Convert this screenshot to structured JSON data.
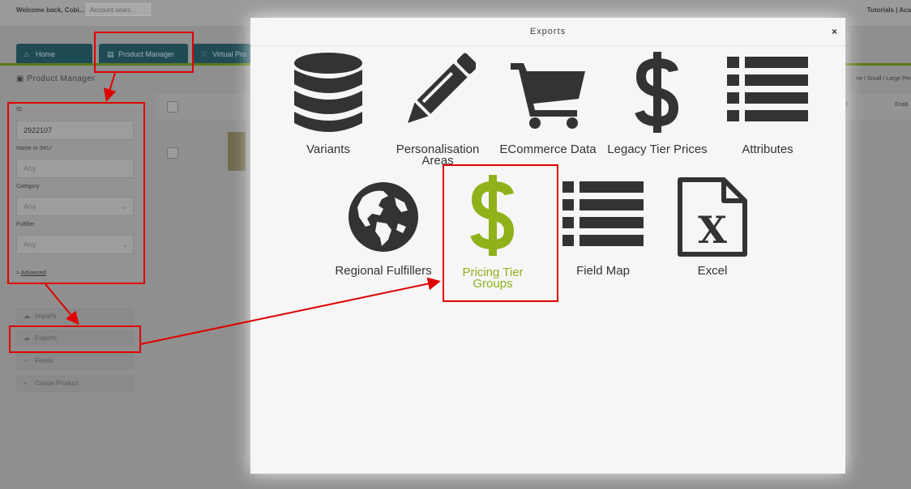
{
  "header": {
    "welcome_text": "Welcome back, Cobi...",
    "search_placeholder": "Account searc...",
    "tutorials_text": "Tutorials | Aca"
  },
  "nav": {
    "tabs": [
      {
        "label": "Home"
      },
      {
        "label": "Product Manager"
      },
      {
        "label": "Virtual Pro"
      }
    ]
  },
  "page": {
    "title": "Product Manager",
    "size_links": "ne / Small / Large  Per",
    "column_partial_1": "d",
    "column_partial_2": "Enab"
  },
  "filters": {
    "id_label": "ID",
    "id_value": "2922107",
    "name_label": "Name or SKU",
    "name_value": "Any",
    "category_label": "Category",
    "category_value": "Any",
    "fulfiller_label": "Fulfiller",
    "fulfiller_value": "Any",
    "advanced_prefix": "> ",
    "advanced_link": "Advanced"
  },
  "actions": {
    "imports": "Imports",
    "exports": "Exports",
    "feeds": "Feeds",
    "create_product": "Create Product"
  },
  "modal": {
    "title": "Exports",
    "close": "×",
    "items": [
      {
        "label": "Variants",
        "icon": "database-icon"
      },
      {
        "label": "Personalisation Areas",
        "icon": "pencil-icon"
      },
      {
        "label": "ECommerce Data",
        "icon": "shopping-cart-icon"
      },
      {
        "label": "Legacy Tier Prices",
        "icon": "dollar-icon"
      },
      {
        "label": "Attributes",
        "icon": "list-icon"
      },
      {
        "label": "Regional Fulfillers",
        "icon": "globe-icon"
      },
      {
        "label": "Pricing Tier Groups",
        "icon": "dollar-icon"
      },
      {
        "label": "Field Map",
        "icon": "list-icon"
      },
      {
        "label": "Excel",
        "icon": "excel-file-icon"
      }
    ]
  },
  "colors": {
    "accent_green": "#8fb11a",
    "icon_dark": "#333333",
    "annotation_red": "#e00000",
    "tab_bg": "#1f4b55"
  }
}
